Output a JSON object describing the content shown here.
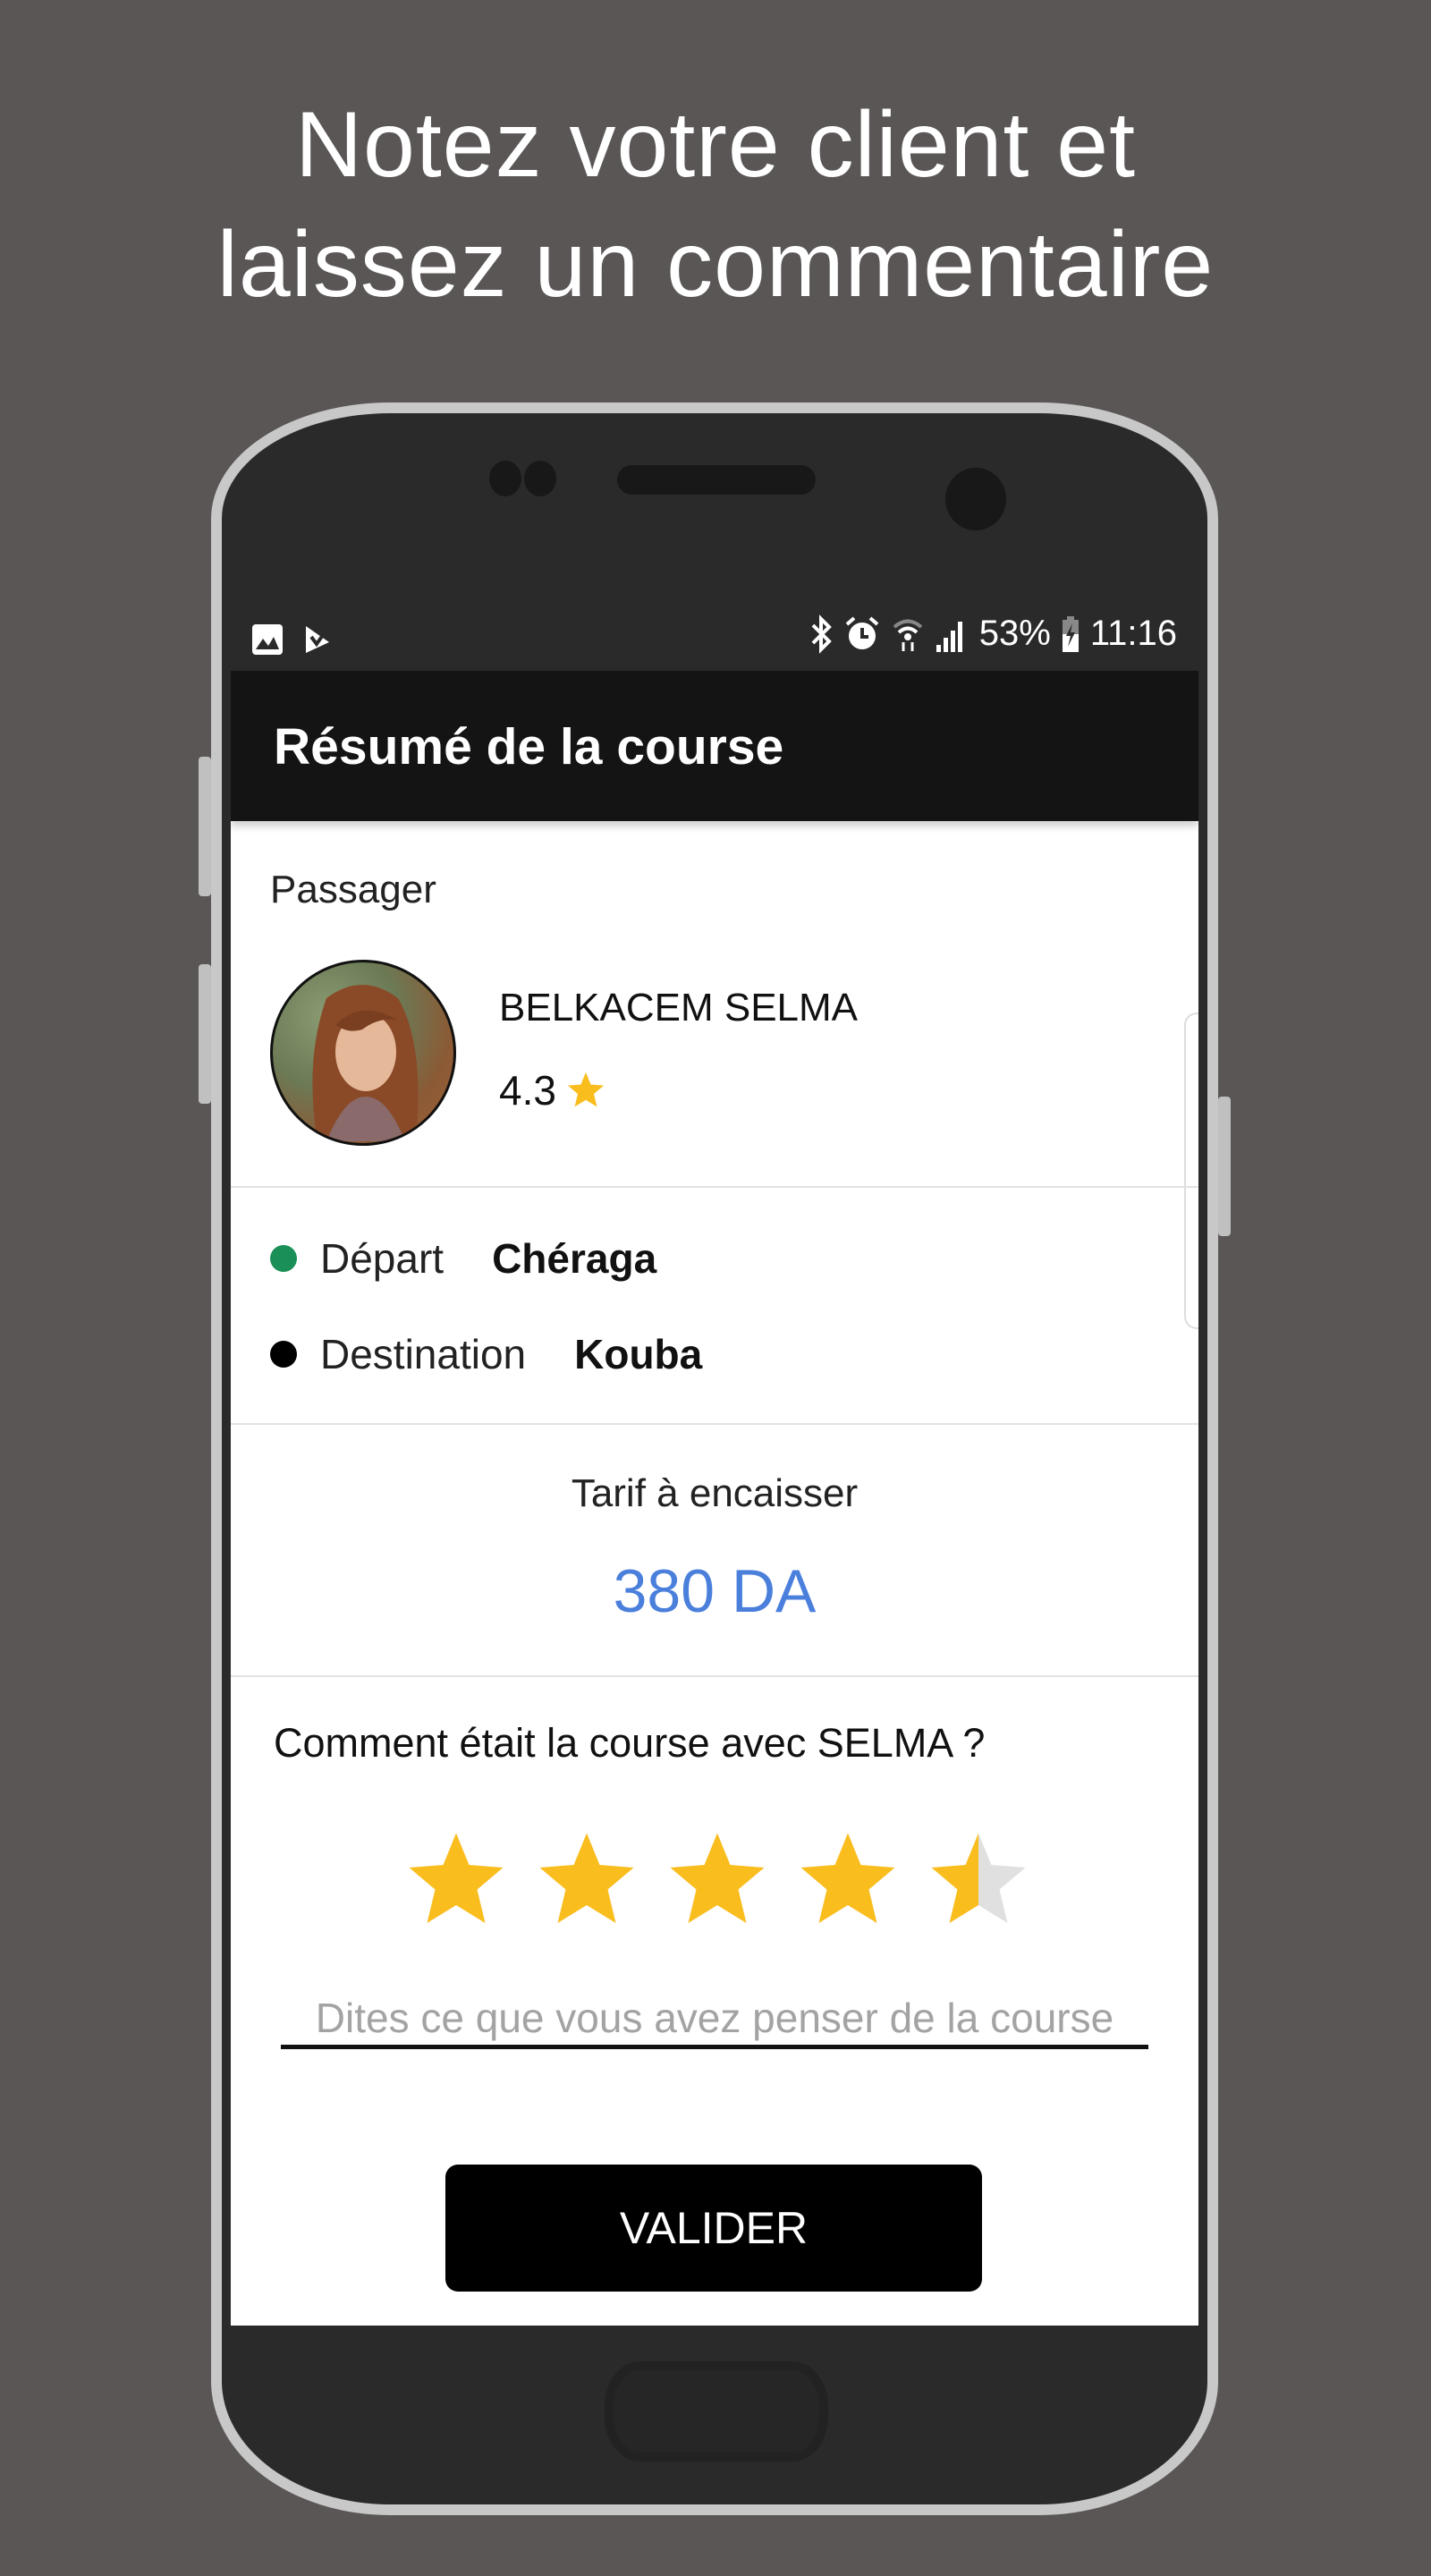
{
  "headline": {
    "line1": "Notez votre client et",
    "line2": "laissez un commentaire"
  },
  "status_bar": {
    "left_icons": [
      "image-icon",
      "check-flag-icon"
    ],
    "right_icons": [
      "bluetooth-icon",
      "alarm-icon",
      "wifi-icon",
      "signal-icon"
    ],
    "battery": "53%",
    "time": "11:16"
  },
  "app_bar": {
    "title": "Résumé de la course"
  },
  "passenger": {
    "section_label": "Passager",
    "name": "BELKACEM SELMA",
    "rating": "4.3"
  },
  "trip": {
    "departure_label": "Départ",
    "departure_value": "Chéraga",
    "destination_label": "Destination",
    "destination_value": "Kouba"
  },
  "fare": {
    "label": "Tarif à encaisser",
    "value": "380 DA"
  },
  "feedback": {
    "question": "Comment était la course avec SELMA ?",
    "rating_value": 4.5,
    "rating_max": 5,
    "comment_placeholder": "Dites ce que vous avez penser de la course",
    "comment_value": ""
  },
  "actions": {
    "submit_label": "VALIDER"
  },
  "colors": {
    "star": "#f9bd1e",
    "star_empty": "#e0e0e0",
    "fare": "#4a7fdc",
    "departure_dot": "#1a8f57",
    "destination_dot": "#000000",
    "background": "#5a5655"
  }
}
